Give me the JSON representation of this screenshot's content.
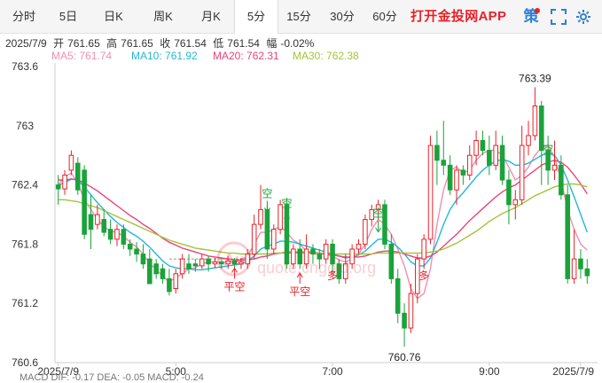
{
  "tabs": [
    {
      "label": "分时",
      "x": 0,
      "w": 54
    },
    {
      "label": "5日",
      "x": 54,
      "w": 46
    },
    {
      "label": "日K",
      "x": 100,
      "w": 56
    },
    {
      "label": "周K",
      "x": 156,
      "w": 56
    },
    {
      "label": "月K",
      "x": 212,
      "w": 52
    },
    {
      "label": "5分",
      "x": 264,
      "w": 48,
      "active": true
    },
    {
      "label": "15分",
      "x": 312,
      "w": 50
    },
    {
      "label": "30分",
      "x": 362,
      "w": 48
    },
    {
      "label": "60分",
      "x": 410,
      "w": 48
    }
  ],
  "brand": "打开金投网APP",
  "tools": {
    "ce": "策",
    "fullscreen": "⛶",
    "settings": "⚙"
  },
  "ohlc": {
    "date": "2025/7/9",
    "open_label": "开",
    "open": "761.65",
    "high_label": "高",
    "high": "761.65",
    "close_label": "收",
    "close": "761.54",
    "low_label": "低",
    "low": "761.54",
    "range_label": "幅",
    "range": "-0.02%"
  },
  "ma_legend": [
    {
      "label": "MA5: 761.74",
      "color": "#f08fb3"
    },
    {
      "label": "MA10: 761.92",
      "color": "#22b8d6"
    },
    {
      "label": "MA20: 762.31",
      "color": "#e8437a"
    },
    {
      "label": "MA30: 762.38",
      "color": "#a6c23a"
    }
  ],
  "bottom_text": "MACD  DIF: -0.17     DEA: -0.05     MACD: -0.24",
  "watermark": {
    "line1": "Au",
    "line2": "quote.cngold.org"
  },
  "chart_data": {
    "type": "candlestick",
    "ylim": [
      760.6,
      763.6
    ],
    "yticks": [
      763.6,
      763,
      762.4,
      761.8,
      761.2,
      760.6
    ],
    "xlabels": [
      {
        "label": "2025/7/9",
        "index": 0
      },
      {
        "label": "5:00",
        "index": 18
      },
      {
        "label": "7:00",
        "index": 42
      },
      {
        "label": "9:00",
        "index": 66
      },
      {
        "label": "2025/7/9",
        "index": 80
      }
    ],
    "up_color": "#e8222b",
    "down_color": "#1aa33a",
    "candles": [
      [
        762.4,
        762.36,
        762.5,
        762.2
      ],
      [
        762.36,
        762.5,
        762.55,
        762.3
      ],
      [
        762.55,
        762.7,
        762.75,
        762.5
      ],
      [
        762.62,
        762.35,
        762.68,
        762.3
      ],
      [
        762.55,
        761.9,
        762.6,
        761.85
      ],
      [
        762.1,
        761.95,
        762.3,
        761.75
      ],
      [
        762.0,
        762.1,
        762.2,
        761.95
      ],
      [
        762.05,
        761.92,
        762.15,
        761.88
      ],
      [
        761.95,
        761.85,
        762.05,
        761.8
      ],
      [
        761.85,
        761.95,
        762.0,
        761.78
      ],
      [
        761.95,
        761.8,
        762.0,
        761.75
      ],
      [
        761.8,
        761.75,
        761.85,
        761.68
      ],
      [
        761.75,
        761.7,
        761.82,
        761.62
      ],
      [
        761.7,
        761.6,
        761.8,
        761.55
      ],
      [
        761.65,
        761.4,
        761.75,
        761.4
      ],
      [
        761.6,
        761.5,
        761.65,
        761.45
      ],
      [
        761.55,
        761.45,
        761.6,
        761.4
      ],
      [
        761.45,
        761.32,
        761.55,
        761.28
      ],
      [
        761.35,
        761.5,
        761.55,
        761.3
      ],
      [
        761.5,
        761.65,
        761.7,
        761.45
      ],
      [
        761.6,
        761.55,
        761.7,
        761.5
      ],
      [
        761.6,
        761.58,
        761.65,
        761.52
      ],
      [
        761.58,
        761.65,
        761.7,
        761.55
      ],
      [
        761.65,
        761.6,
        761.68,
        761.52
      ],
      [
        761.6,
        761.62,
        761.66,
        761.56
      ],
      [
        761.62,
        761.6,
        761.66,
        761.55
      ],
      [
        761.6,
        761.63,
        761.68,
        761.55
      ],
      [
        761.63,
        761.6,
        761.66,
        761.55
      ],
      [
        761.6,
        761.62,
        761.66,
        761.55
      ],
      [
        761.6,
        761.7,
        761.75,
        761.55
      ],
      [
        761.7,
        762.0,
        762.1,
        761.65
      ],
      [
        762.0,
        762.15,
        762.4,
        761.95
      ],
      [
        762.15,
        761.75,
        762.2,
        761.65
      ],
      [
        761.75,
        761.95,
        762.0,
        761.7
      ],
      [
        761.95,
        762.2,
        762.25,
        761.9
      ],
      [
        762.2,
        761.6,
        762.25,
        761.55
      ],
      [
        761.6,
        761.75,
        761.8,
        761.55
      ],
      [
        761.75,
        761.6,
        761.85,
        761.55
      ],
      [
        761.6,
        761.75,
        761.9,
        761.55
      ],
      [
        761.75,
        761.7,
        761.8,
        761.6
      ],
      [
        761.7,
        761.65,
        761.75,
        761.55
      ],
      [
        761.65,
        761.8,
        761.85,
        761.6
      ],
      [
        761.8,
        761.6,
        761.85,
        761.5
      ],
      [
        761.6,
        761.45,
        761.65,
        761.4
      ],
      [
        761.45,
        761.6,
        761.7,
        761.4
      ],
      [
        761.6,
        761.75,
        761.8,
        761.55
      ],
      [
        761.75,
        761.8,
        761.85,
        761.7
      ],
      [
        761.8,
        762.05,
        762.1,
        761.75
      ],
      [
        762.05,
        762.15,
        762.2,
        761.98
      ],
      [
        762.15,
        762.2,
        762.25,
        762.05
      ],
      [
        762.2,
        761.8,
        762.25,
        761.75
      ],
      [
        761.8,
        761.45,
        761.9,
        761.4
      ],
      [
        761.45,
        761.1,
        761.55,
        761.0
      ],
      [
        761.1,
        760.95,
        761.2,
        760.76
      ],
      [
        760.95,
        761.3,
        761.4,
        760.9
      ],
      [
        761.3,
        761.65,
        761.7,
        761.2
      ],
      [
        761.65,
        761.85,
        761.9,
        761.55
      ],
      [
        761.85,
        762.8,
        762.9,
        761.8
      ],
      [
        762.8,
        762.65,
        762.95,
        762.4
      ],
      [
        762.65,
        762.6,
        763.05,
        762.5
      ],
      [
        762.6,
        762.35,
        762.7,
        762.3
      ],
      [
        762.35,
        762.55,
        762.6,
        762.2
      ],
      [
        762.55,
        762.5,
        762.6,
        762.4
      ],
      [
        762.5,
        762.7,
        762.8,
        762.45
      ],
      [
        762.7,
        762.85,
        762.95,
        762.6
      ],
      [
        762.85,
        762.75,
        762.95,
        762.7
      ],
      [
        762.75,
        762.6,
        762.9,
        762.5
      ],
      [
        762.6,
        762.8,
        762.95,
        762.55
      ],
      [
        762.8,
        762.45,
        762.9,
        762.4
      ],
      [
        762.45,
        762.2,
        762.55,
        762.0
      ],
      [
        762.2,
        762.25,
        762.35,
        762.05
      ],
      [
        762.25,
        762.8,
        763.0,
        762.2
      ],
      [
        762.8,
        762.9,
        763.05,
        762.7
      ],
      [
        762.9,
        763.2,
        763.39,
        762.85
      ],
      [
        763.2,
        762.75,
        763.25,
        762.4
      ],
      [
        762.75,
        762.55,
        762.9,
        762.4
      ],
      [
        762.55,
        762.6,
        762.85,
        762.45
      ],
      [
        762.6,
        762.3,
        762.7,
        762.25
      ],
      [
        762.3,
        761.45,
        762.4,
        761.4
      ],
      [
        761.45,
        761.65,
        761.95,
        761.4
      ],
      [
        761.65,
        761.55,
        761.75,
        761.45
      ],
      [
        761.55,
        761.48,
        761.65,
        761.4
      ]
    ],
    "series": [
      {
        "name": "MA5",
        "color": "#f08fb3"
      },
      {
        "name": "MA10",
        "color": "#22b8d6"
      },
      {
        "name": "MA20",
        "color": "#e8437a"
      },
      {
        "name": "MA30",
        "color": "#a6c23a"
      }
    ],
    "ma_values": {
      "MA5": [
        762.4,
        762.48,
        762.52,
        762.42,
        762.25,
        762.15,
        762.05,
        761.98,
        761.93,
        761.92,
        761.88,
        761.82,
        761.77,
        761.7,
        761.6,
        761.55,
        761.47,
        761.42,
        761.46,
        761.5,
        761.55,
        761.56,
        761.6,
        761.62,
        761.62,
        761.62,
        761.62,
        761.62,
        761.64,
        761.68,
        761.8,
        761.92,
        761.92,
        761.95,
        761.98,
        761.92,
        761.84,
        761.8,
        761.73,
        761.7,
        761.7,
        761.7,
        761.68,
        761.64,
        761.62,
        761.65,
        761.7,
        761.8,
        761.95,
        762.05,
        762.0,
        761.9,
        761.75,
        761.58,
        761.35,
        761.25,
        761.3,
        761.55,
        762.0,
        762.35,
        762.55,
        762.58,
        762.52,
        762.55,
        762.65,
        762.72,
        762.75,
        762.75,
        762.7,
        762.58,
        762.45,
        762.5,
        762.58,
        762.7,
        762.78,
        762.8,
        762.68,
        762.45,
        762.15,
        761.95,
        761.8,
        761.74
      ],
      "MA10": [
        762.4,
        762.42,
        762.46,
        762.45,
        762.38,
        762.3,
        762.22,
        762.15,
        762.08,
        762.02,
        761.97,
        761.92,
        761.88,
        761.83,
        761.77,
        761.7,
        761.63,
        761.58,
        761.56,
        761.55,
        761.55,
        761.54,
        761.54,
        761.55,
        761.56,
        761.57,
        761.58,
        761.59,
        761.6,
        761.63,
        761.68,
        761.75,
        761.78,
        761.8,
        761.83,
        761.83,
        761.82,
        761.8,
        761.78,
        761.76,
        761.74,
        761.72,
        761.7,
        761.68,
        761.66,
        761.67,
        761.69,
        761.73,
        761.79,
        761.85,
        761.85,
        761.82,
        761.77,
        761.7,
        761.62,
        761.58,
        761.58,
        761.66,
        761.82,
        762.0,
        762.15,
        762.25,
        762.32,
        762.4,
        762.48,
        762.55,
        762.6,
        762.64,
        762.66,
        762.64,
        762.6,
        762.6,
        762.62,
        762.66,
        762.7,
        762.72,
        762.7,
        762.6,
        762.45,
        762.28,
        762.1,
        761.92
      ],
      "MA20": [
        762.45,
        762.45,
        762.46,
        762.45,
        762.42,
        762.38,
        762.34,
        762.29,
        762.24,
        762.19,
        762.14,
        762.09,
        762.05,
        762.0,
        761.96,
        761.91,
        761.86,
        761.82,
        761.79,
        761.76,
        761.74,
        761.72,
        761.7,
        761.68,
        761.67,
        761.66,
        761.65,
        761.64,
        761.64,
        761.64,
        761.65,
        761.67,
        761.68,
        761.7,
        761.71,
        761.72,
        761.72,
        761.72,
        761.72,
        761.72,
        761.71,
        761.7,
        761.69,
        761.68,
        761.67,
        761.67,
        761.67,
        761.68,
        761.7,
        761.72,
        761.73,
        761.73,
        761.72,
        761.7,
        761.68,
        761.66,
        761.66,
        761.68,
        761.72,
        761.78,
        761.84,
        761.9,
        761.97,
        762.04,
        762.1,
        762.16,
        762.22,
        762.28,
        762.33,
        762.37,
        762.4,
        762.45,
        762.5,
        762.55,
        762.6,
        762.63,
        762.65,
        762.63,
        762.58,
        762.5,
        762.41,
        762.31
      ],
      "MA30": [
        762.25,
        762.25,
        762.24,
        762.23,
        762.21,
        762.19,
        762.17,
        762.14,
        762.11,
        762.08,
        762.05,
        762.02,
        761.99,
        761.96,
        761.93,
        761.9,
        761.87,
        761.84,
        761.82,
        761.8,
        761.78,
        761.76,
        761.75,
        761.74,
        761.73,
        761.72,
        761.71,
        761.71,
        761.7,
        761.7,
        761.7,
        761.7,
        761.7,
        761.71,
        761.71,
        761.71,
        761.71,
        761.71,
        761.71,
        761.71,
        761.71,
        761.71,
        761.7,
        761.7,
        761.7,
        761.7,
        761.7,
        761.7,
        761.7,
        761.71,
        761.71,
        761.71,
        761.71,
        761.71,
        761.71,
        761.71,
        761.71,
        761.72,
        761.73,
        761.75,
        761.78,
        761.81,
        761.85,
        761.89,
        761.93,
        761.98,
        762.03,
        762.07,
        762.11,
        762.14,
        762.17,
        762.21,
        762.25,
        762.29,
        762.32,
        762.35,
        762.38,
        762.4,
        762.41,
        762.41,
        762.4,
        762.38
      ]
    },
    "annotations": [
      {
        "text": "763.39",
        "index": 73,
        "value": 763.39,
        "pos": "above"
      },
      {
        "text": "760.76",
        "index": 53,
        "value": 760.76,
        "pos": "below"
      }
    ],
    "signals": [
      {
        "text": "平空",
        "index": 27,
        "value": 761.45,
        "color": "#e8222b",
        "arrow": "up"
      },
      {
        "text": "空",
        "index": 32,
        "value": 762.15,
        "color": "#1aa33a",
        "arrow": "down"
      },
      {
        "text": "空",
        "index": 35,
        "value": 762.05,
        "color": "#1aa33a",
        "arrow": "down"
      },
      {
        "text": "平空",
        "index": 37,
        "value": 761.4,
        "color": "#e8222b",
        "arrow": "up"
      },
      {
        "text": "多",
        "index": 42,
        "value": 761.5,
        "color": "#e8222b",
        "arrow": "none"
      },
      {
        "text": "空",
        "index": 49,
        "value": 761.95,
        "color": "#1aa33a",
        "arrow": "down"
      },
      {
        "text": "多",
        "index": 56,
        "value": 761.5,
        "color": "#e8222b",
        "arrow": "none"
      },
      {
        "text": "空",
        "index": 75,
        "value": 762.6,
        "color": "#1aa33a",
        "arrow": "down"
      }
    ]
  }
}
